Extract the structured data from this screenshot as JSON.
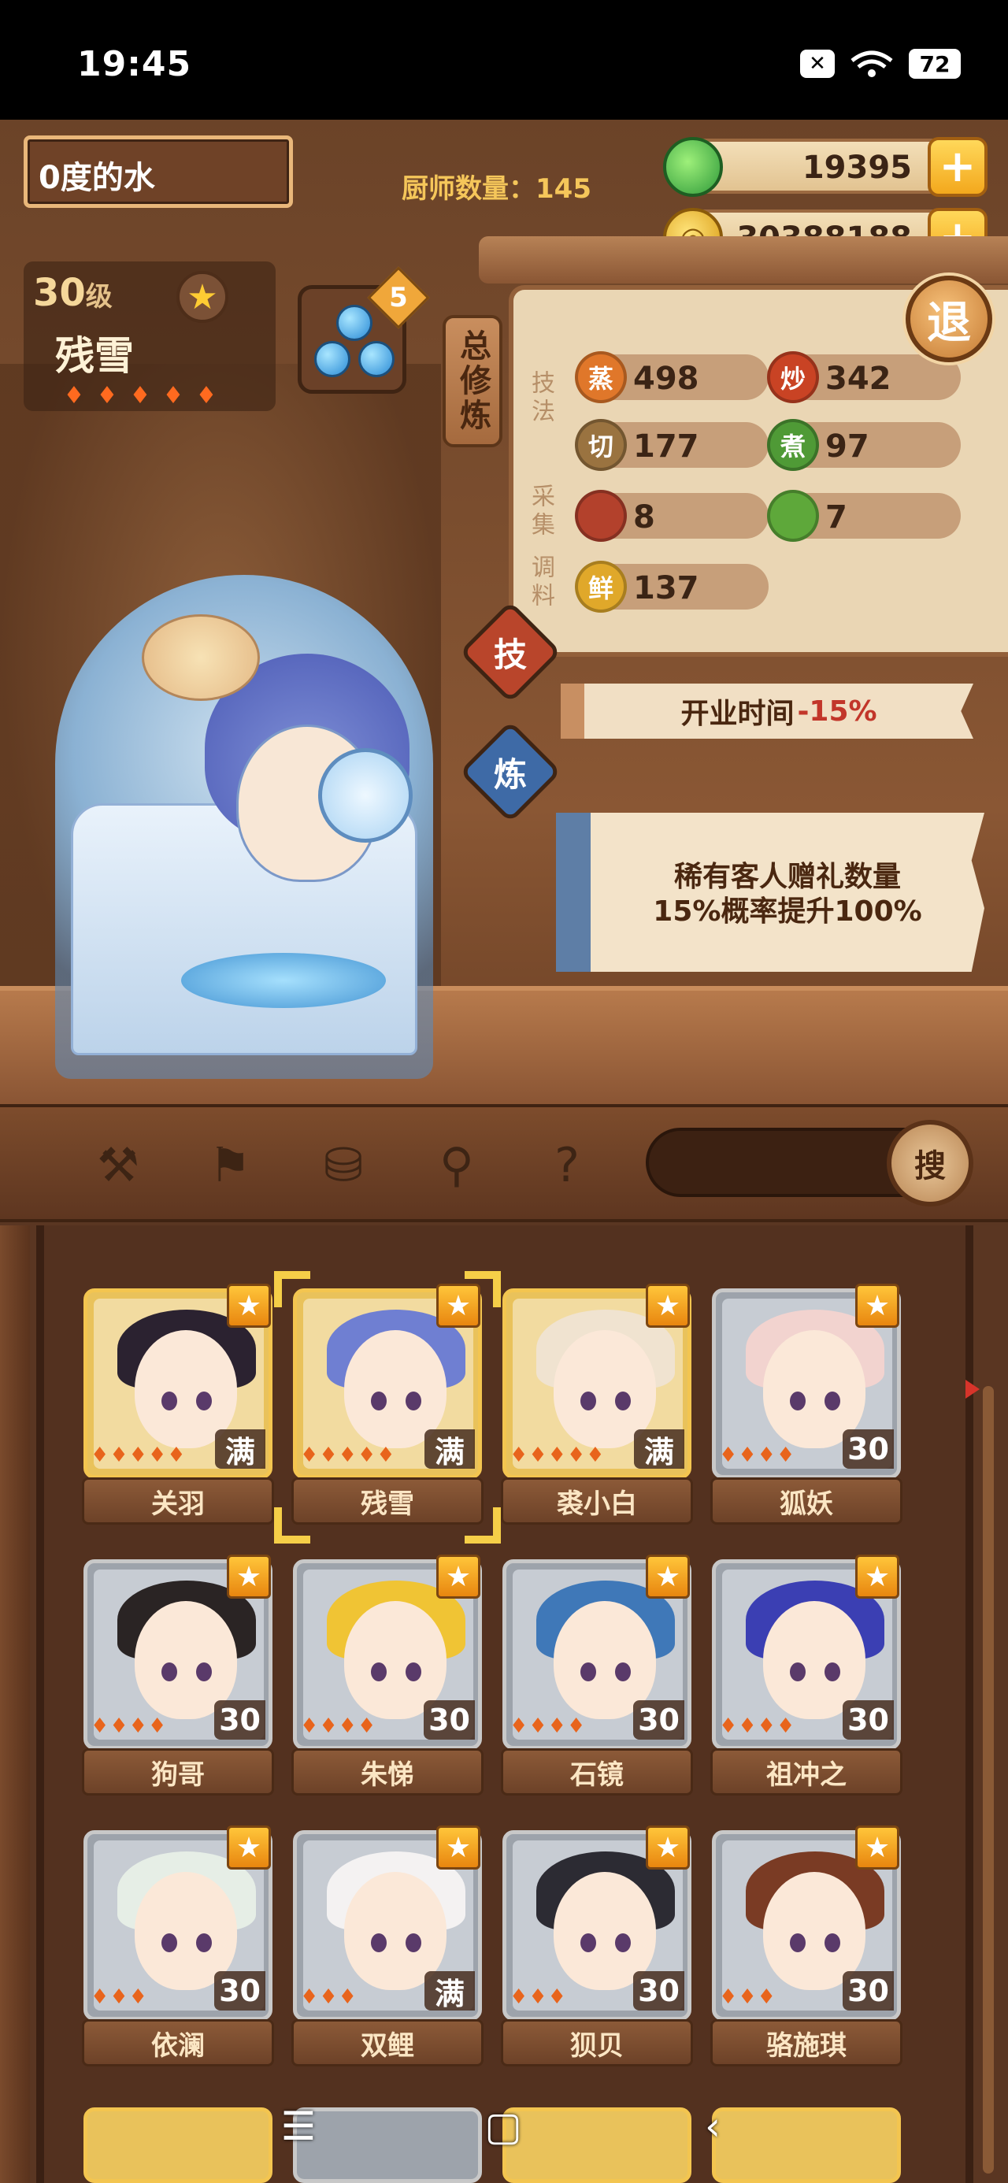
{
  "status": {
    "time": "19:45",
    "battery": "72",
    "close_glyph": "✕"
  },
  "player": {
    "name": "0度的水",
    "chef_count_label": "厨师数量：",
    "chef_count": "145"
  },
  "currency": {
    "jade": "19395",
    "coins": "30388188",
    "plus": "+"
  },
  "chef": {
    "level": "30",
    "level_unit": "级",
    "name": "残雪",
    "stars": 5,
    "equip_count": "5"
  },
  "tabs": {
    "train": "总修炼",
    "skill": "技",
    "refine": "炼",
    "exit": "退"
  },
  "categories": {
    "technique": "技法",
    "gather": "采集",
    "seasoning": "调料"
  },
  "stats": [
    {
      "icon": "蒸",
      "value": "498",
      "color": "#e0772a"
    },
    {
      "icon": "炒",
      "value": "342",
      "color": "#c94324"
    },
    {
      "icon": "切",
      "value": "177",
      "color": "#9a7340"
    },
    {
      "icon": "煮",
      "value": "97",
      "color": "#4f9a36"
    },
    {
      "icon": "",
      "value": "8",
      "color": "#b3412c"
    },
    {
      "icon": "",
      "value": "7",
      "color": "#5ea83a"
    },
    {
      "icon": "鲜",
      "value": "137",
      "color": "#e0a82a"
    }
  ],
  "bonus": {
    "open_time": "开业时间",
    "open_pct": "-15%",
    "note_line1": "稀有客人赠礼数量",
    "note_line2": "15%概率提升100%"
  },
  "filters": {
    "search_label": "搜"
  },
  "chefs": [
    {
      "name": "关羽",
      "badge": "满",
      "gold": true,
      "hair": "#2b2230",
      "flames": 5
    },
    {
      "name": "残雪",
      "badge": "满",
      "gold": true,
      "hair": "#6f7fd2",
      "flames": 5
    },
    {
      "name": "裘小白",
      "badge": "满",
      "gold": true,
      "hair": "#f0e3d0",
      "flames": 5
    },
    {
      "name": "狐妖",
      "badge": "30",
      "gold": false,
      "hair": "#f2d3cf",
      "flames": 4
    },
    {
      "name": "狗哥",
      "badge": "30",
      "gold": false,
      "hair": "#2a2424",
      "flames": 4
    },
    {
      "name": "朱悌",
      "badge": "30",
      "gold": false,
      "hair": "#f0c434",
      "flames": 4
    },
    {
      "name": "石镜",
      "badge": "30",
      "gold": false,
      "hair": "#3f78b8",
      "flames": 4
    },
    {
      "name": "祖冲之",
      "badge": "30",
      "gold": false,
      "hair": "#3b3fb3",
      "flames": 4
    },
    {
      "name": "依澜",
      "badge": "30",
      "gold": false,
      "hair": "#e6eee6",
      "flames": 3
    },
    {
      "name": "双鲤",
      "badge": "满",
      "gold": false,
      "hair": "#f4f2f2",
      "flames": 3
    },
    {
      "name": "狈贝",
      "badge": "30",
      "gold": false,
      "hair": "#2c2b33",
      "flames": 3
    },
    {
      "name": "骆施琪",
      "badge": "30",
      "gold": false,
      "hair": "#7a3b24",
      "flames": 3
    }
  ],
  "nav": {
    "menu": "☰",
    "home": "▢",
    "back": "‹"
  }
}
